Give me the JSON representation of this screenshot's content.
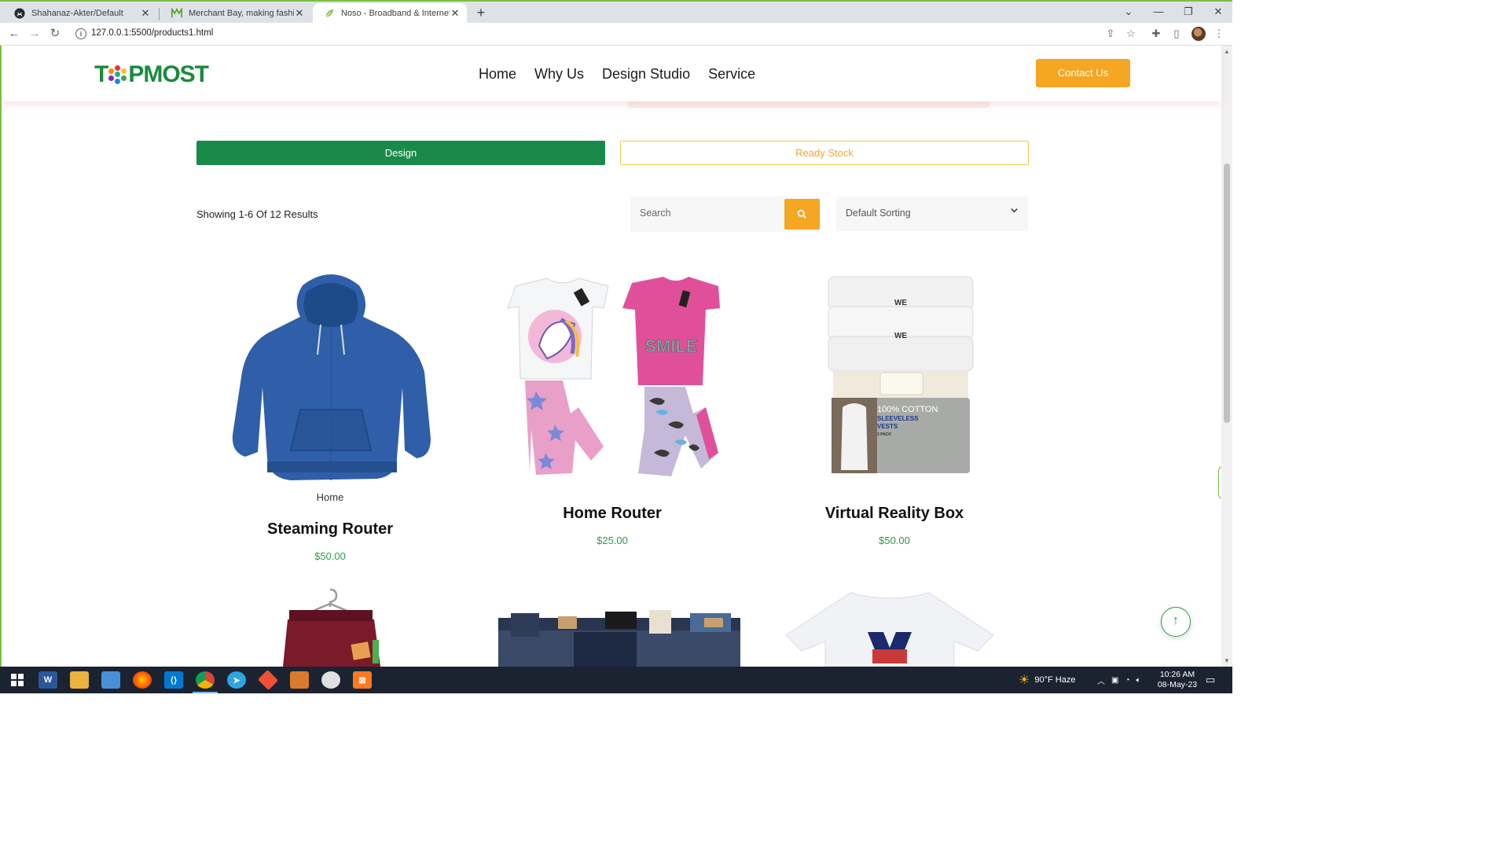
{
  "browser": {
    "tabs": [
      {
        "title": "Shahanaz-Akter/Default",
        "icon": "github-icon",
        "active": false
      },
      {
        "title": "Merchant Bay, making fashion so",
        "icon": "merchantbay-icon",
        "active": false
      },
      {
        "title": "Noso - Broadband & Internet Se",
        "icon": "leaf-icon",
        "active": true
      }
    ],
    "close_glyph": "✕",
    "new_tab_glyph": "+",
    "url": "127.0.0.1:5500/products1.html"
  },
  "site": {
    "logo_text_left": "T",
    "logo_text_right": "PMOST",
    "nav": [
      "Home",
      "Why Us",
      "Design Studio",
      "Service"
    ],
    "contact_label": "Contact Us",
    "tabs": {
      "design": "Design",
      "ready_stock": "Ready Stock"
    },
    "results_text": "Showing 1-6 Of 12 Results",
    "search_placeholder": "Search",
    "sort_label": "Default Sorting",
    "products": [
      {
        "category": "Home",
        "title": "Steaming Router",
        "price": "$50.00",
        "image": "blue-hoodie"
      },
      {
        "category": "",
        "title": "Home Router",
        "price": "$25.00",
        "image": "kids-pajama-sets"
      },
      {
        "category": "",
        "title": "Virtual Reality Box",
        "price": "$50.00",
        "image": "cotton-vests-pack"
      },
      {
        "category": "",
        "title": "",
        "price": "",
        "image": "maroon-shorts-on-hanger"
      },
      {
        "category": "",
        "title": "",
        "price": "",
        "image": "stacked-jeans"
      },
      {
        "category": "",
        "title": "",
        "price": "",
        "image": "white-tshirt"
      }
    ],
    "vest_pack_text": {
      "line1": "100% COTTON",
      "line2": "SLEEVELESS",
      "line3": "VESTS",
      "line4": "3 PACK",
      "brand": "WE"
    },
    "shirt_text": "SMILE",
    "to_top_glyph": "↑"
  },
  "taskbar": {
    "weather": "90°F  Haze",
    "time": "10:26 AM",
    "date": "08-May-23"
  },
  "colors": {
    "green": "#1a8a4a",
    "orange": "#f5a623",
    "price_green": "#2e9a4a"
  }
}
